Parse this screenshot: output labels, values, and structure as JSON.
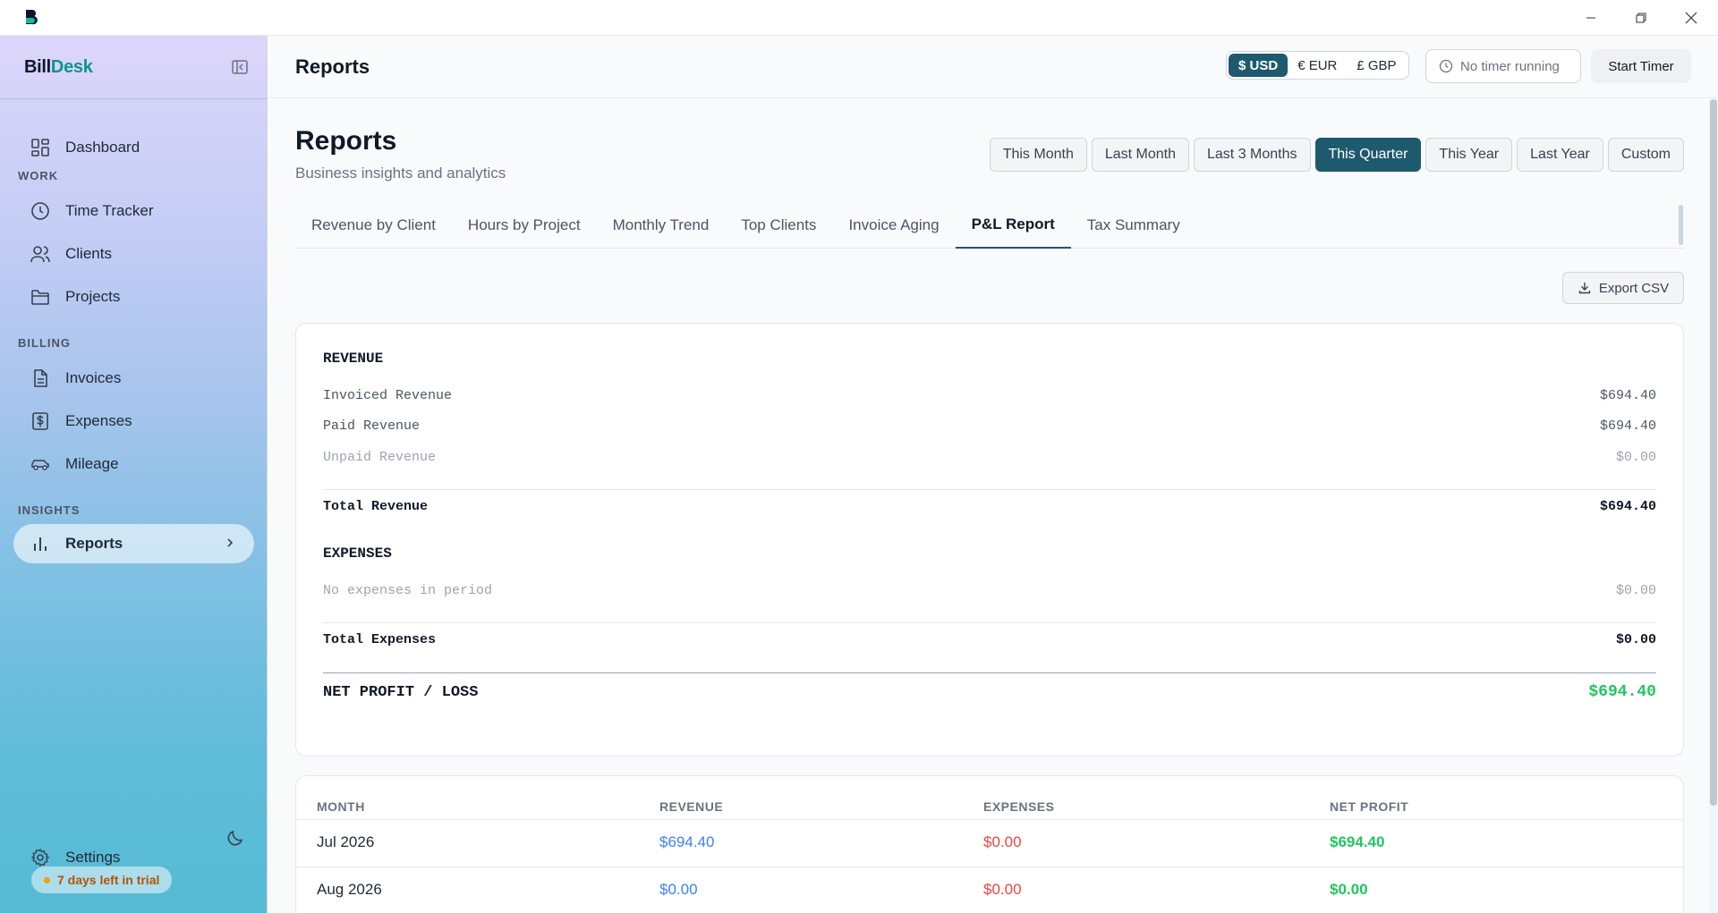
{
  "window": {
    "app_icon": "billdesk-logo-icon"
  },
  "sidebar": {
    "brand_part1": "Bill",
    "brand_part2": "Desk",
    "items": [
      {
        "label": "Dashboard",
        "icon": "grid-icon"
      },
      {
        "section": "WORK"
      },
      {
        "label": "Time Tracker",
        "icon": "clock-icon"
      },
      {
        "label": "Clients",
        "icon": "users-icon"
      },
      {
        "label": "Projects",
        "icon": "folder-icon"
      },
      {
        "section": "BILLING"
      },
      {
        "label": "Invoices",
        "icon": "document-icon"
      },
      {
        "label": "Expenses",
        "icon": "dollar-icon"
      },
      {
        "label": "Mileage",
        "icon": "car-icon"
      },
      {
        "section": "INSIGHTS"
      },
      {
        "label": "Reports",
        "icon": "bar-chart-icon",
        "active": true
      }
    ],
    "sections": {
      "work": "WORK",
      "billing": "BILLING",
      "insights": "INSIGHTS"
    },
    "settings_label": "Settings",
    "trial_text": "7 days left in trial"
  },
  "header": {
    "title": "Reports",
    "currencies": [
      {
        "label": "$ USD",
        "active": true
      },
      {
        "label": "€ EUR",
        "active": false
      },
      {
        "label": "£ GBP",
        "active": false
      }
    ],
    "timer_status": "No timer running",
    "start_timer": "Start Timer"
  },
  "page": {
    "title": "Reports",
    "subtitle": "Business insights and analytics",
    "ranges": [
      {
        "label": "This Month",
        "active": false
      },
      {
        "label": "Last Month",
        "active": false
      },
      {
        "label": "Last 3 Months",
        "active": false
      },
      {
        "label": "This Quarter",
        "active": true
      },
      {
        "label": "This Year",
        "active": false
      },
      {
        "label": "Last Year",
        "active": false
      },
      {
        "label": "Custom",
        "active": false
      }
    ],
    "tabs": [
      {
        "label": "Revenue by Client",
        "active": false
      },
      {
        "label": "Hours by Project",
        "active": false
      },
      {
        "label": "Monthly Trend",
        "active": false
      },
      {
        "label": "Top Clients",
        "active": false
      },
      {
        "label": "Invoice Aging",
        "active": false
      },
      {
        "label": "P&L Report",
        "active": true
      },
      {
        "label": "Tax Summary",
        "active": false
      }
    ],
    "export_label": "Export CSV"
  },
  "pl_report": {
    "revenue_heading": "REVENUE",
    "invoiced_label": "Invoiced Revenue",
    "invoiced_value": "$694.40",
    "paid_label": "Paid Revenue",
    "paid_value": "$694.40",
    "unpaid_label": "Unpaid Revenue",
    "unpaid_value": "$0.00",
    "total_revenue_label": "Total Revenue",
    "total_revenue_value": "$694.40",
    "expenses_heading": "EXPENSES",
    "no_expenses_label": "No expenses in period",
    "no_expenses_value": "$0.00",
    "total_expenses_label": "Total Expenses",
    "total_expenses_value": "$0.00",
    "net_label": "NET PROFIT / LOSS",
    "net_value": "$694.40"
  },
  "monthly_table": {
    "headers": [
      "MONTH",
      "REVENUE",
      "EXPENSES",
      "NET PROFIT"
    ],
    "rows": [
      [
        "Jul 2026",
        "$694.40",
        "$0.00",
        "$694.40"
      ],
      [
        "Aug 2026",
        "$0.00",
        "$0.00",
        "$0.00"
      ]
    ]
  },
  "colors": {
    "accent": "#1e5a6e",
    "brand_teal": "#0d9488",
    "revenue_blue": "#3b82f6",
    "expense_red": "#ef4444",
    "profit_green": "#22c55e"
  }
}
